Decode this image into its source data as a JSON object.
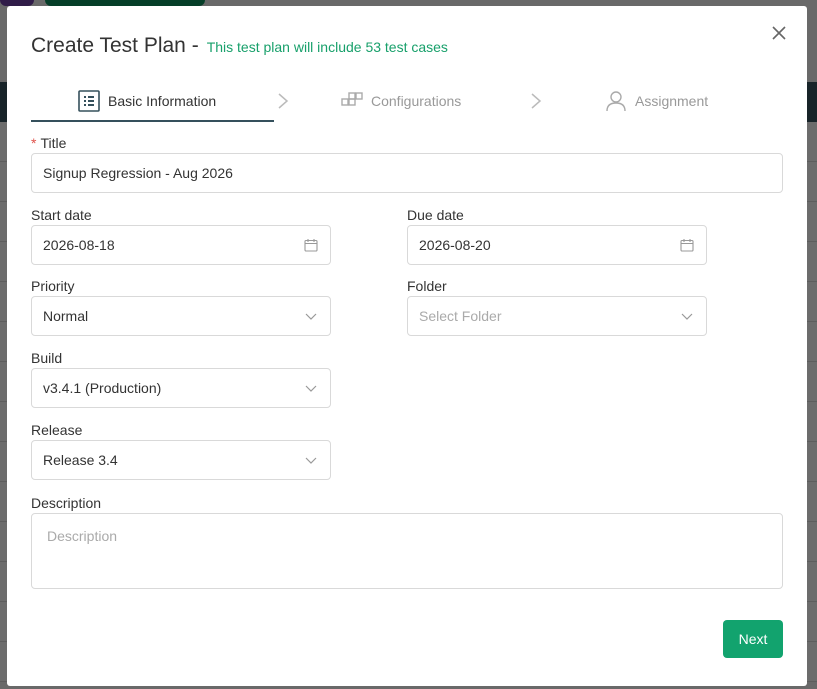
{
  "modal": {
    "title": "Create Test Plan -",
    "subtitle": "This test plan will include 53 test cases",
    "close_icon": "close-icon"
  },
  "steps": [
    {
      "label": "Basic Information",
      "icon": "list-icon",
      "active": true
    },
    {
      "label": "Configurations",
      "icon": "configurations-icon",
      "active": false
    },
    {
      "label": "Assignment",
      "icon": "user-icon",
      "active": false
    }
  ],
  "form": {
    "title": {
      "label": "Title",
      "value": "Signup Regression - Aug 2026",
      "required_marker": "*"
    },
    "start_date": {
      "label": "Start date",
      "value": "2026-08-18",
      "icon": "calendar-icon"
    },
    "due_date": {
      "label": "Due date",
      "value": "2026-08-20",
      "icon": "calendar-icon"
    },
    "priority": {
      "label": "Priority",
      "value": "Normal",
      "icon": "chevron-down-icon"
    },
    "folder": {
      "label": "Folder",
      "placeholder": "Select Folder",
      "icon": "chevron-down-icon"
    },
    "build": {
      "label": "Build",
      "value": "v3.4.1 (Production)",
      "icon": "chevron-down-icon"
    },
    "release": {
      "label": "Release",
      "value": "Release 3.4",
      "icon": "chevron-down-icon"
    },
    "description": {
      "label": "Description",
      "placeholder": "Description"
    }
  },
  "actions": {
    "next_label": "Next"
  },
  "colors": {
    "accent": "#12a36e",
    "subtitle": "#18a06b",
    "step_underline": "#35505c",
    "required": "#e0524b"
  }
}
